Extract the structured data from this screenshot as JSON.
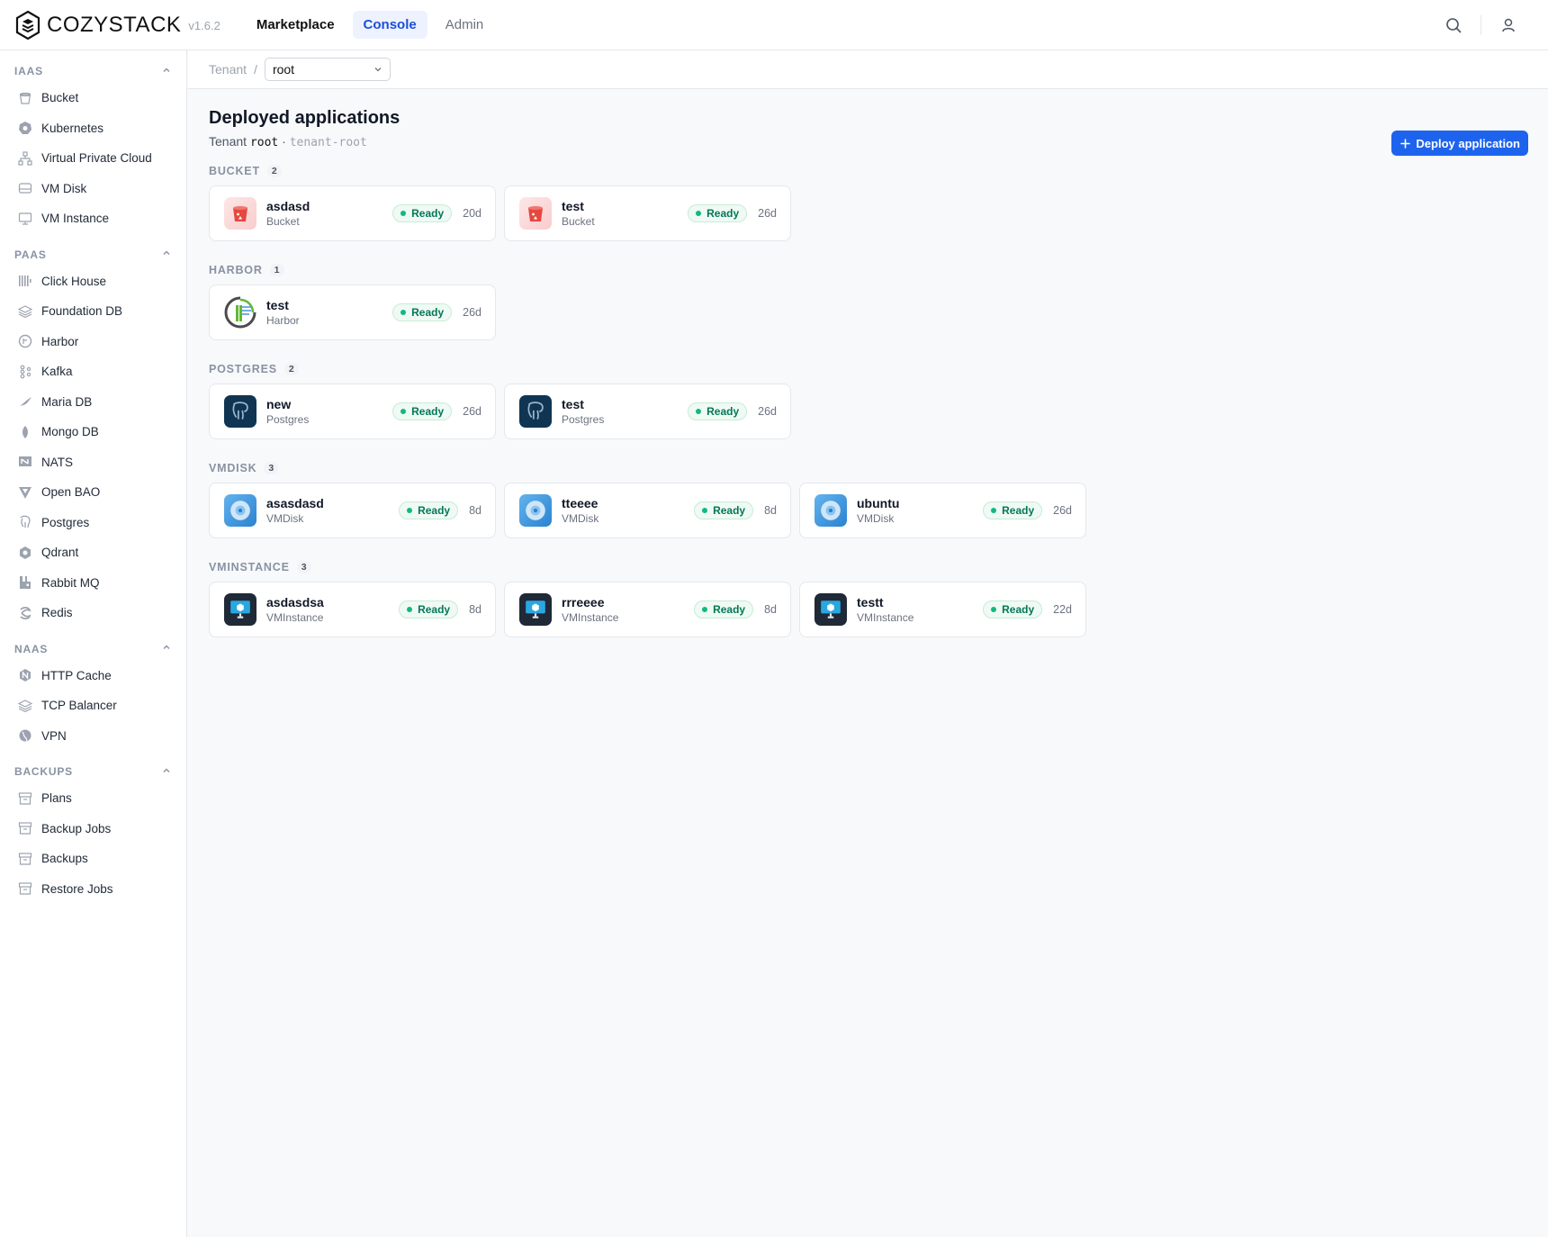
{
  "brand": {
    "name": "COZYSTACK",
    "version": "v1.6.2"
  },
  "topnav": [
    {
      "label": "Marketplace"
    },
    {
      "label": "Console"
    },
    {
      "label": "Admin"
    }
  ],
  "sidebar": {
    "sections": [
      {
        "title": "IAAS",
        "items": [
          {
            "label": "Bucket",
            "icon": "bucket-icon"
          },
          {
            "label": "Kubernetes",
            "icon": "kubernetes-icon"
          },
          {
            "label": "Virtual Private Cloud",
            "icon": "network-icon"
          },
          {
            "label": "VM Disk",
            "icon": "disk-icon"
          },
          {
            "label": "VM Instance",
            "icon": "monitor-icon"
          }
        ]
      },
      {
        "title": "PAAS",
        "items": [
          {
            "label": "Click House",
            "icon": "clickhouse-icon"
          },
          {
            "label": "Foundation DB",
            "icon": "layers-icon"
          },
          {
            "label": "Harbor",
            "icon": "harbor-icon"
          },
          {
            "label": "Kafka",
            "icon": "kafka-icon"
          },
          {
            "label": "Maria DB",
            "icon": "mariadb-icon"
          },
          {
            "label": "Mongo DB",
            "icon": "leaf-icon"
          },
          {
            "label": "NATS",
            "icon": "nats-icon"
          },
          {
            "label": "Open BAO",
            "icon": "openbao-icon"
          },
          {
            "label": "Postgres",
            "icon": "elephant-icon"
          },
          {
            "label": "Qdrant",
            "icon": "qdrant-icon"
          },
          {
            "label": "Rabbit MQ",
            "icon": "rabbitmq-icon"
          },
          {
            "label": "Redis",
            "icon": "redis-icon"
          }
        ]
      },
      {
        "title": "NAAS",
        "items": [
          {
            "label": "HTTP Cache",
            "icon": "nginx-icon"
          },
          {
            "label": "TCP Balancer",
            "icon": "layers-icon"
          },
          {
            "label": "VPN",
            "icon": "globe-icon"
          }
        ]
      },
      {
        "title": "BACKUPS",
        "items": [
          {
            "label": "Plans",
            "icon": "archive-icon"
          },
          {
            "label": "Backup Jobs",
            "icon": "archive-icon"
          },
          {
            "label": "Backups",
            "icon": "archive-icon"
          },
          {
            "label": "Restore Jobs",
            "icon": "archive-icon"
          }
        ]
      }
    ]
  },
  "breadcrumb": {
    "root": "Tenant",
    "separator": "/",
    "selected": "root"
  },
  "page": {
    "title": "Deployed applications",
    "subtitle_prefix": "Tenant",
    "tenant": "root",
    "dot": "·",
    "namespace": "tenant-root",
    "deploy_label": "Deploy application"
  },
  "groups": [
    {
      "title": "BUCKET",
      "count": "2",
      "apps": [
        {
          "name": "asdasd",
          "kind": "Bucket",
          "status": "Ready",
          "age": "20d"
        },
        {
          "name": "test",
          "kind": "Bucket",
          "status": "Ready",
          "age": "26d"
        }
      ]
    },
    {
      "title": "HARBOR",
      "count": "1",
      "apps": [
        {
          "name": "test",
          "kind": "Harbor",
          "status": "Ready",
          "age": "26d"
        }
      ]
    },
    {
      "title": "POSTGRES",
      "count": "2",
      "apps": [
        {
          "name": "new",
          "kind": "Postgres",
          "status": "Ready",
          "age": "26d"
        },
        {
          "name": "test",
          "kind": "Postgres",
          "status": "Ready",
          "age": "26d"
        }
      ]
    },
    {
      "title": "VMDISK",
      "count": "3",
      "apps": [
        {
          "name": "asasdasd",
          "kind": "VMDisk",
          "status": "Ready",
          "age": "8d"
        },
        {
          "name": "tteeee",
          "kind": "VMDisk",
          "status": "Ready",
          "age": "8d"
        },
        {
          "name": "ubuntu",
          "kind": "VMDisk",
          "status": "Ready",
          "age": "26d"
        }
      ]
    },
    {
      "title": "VMINSTANCE",
      "count": "3",
      "apps": [
        {
          "name": "asdasdsa",
          "kind": "VMInstance",
          "status": "Ready",
          "age": "8d"
        },
        {
          "name": "rrreeee",
          "kind": "VMInstance",
          "status": "Ready",
          "age": "8d"
        },
        {
          "name": "testt",
          "kind": "VMInstance",
          "status": "Ready",
          "age": "22d"
        }
      ]
    }
  ],
  "colors": {
    "accent": "#1d63ed",
    "ready": "#10b981",
    "ready_text": "#047857"
  }
}
